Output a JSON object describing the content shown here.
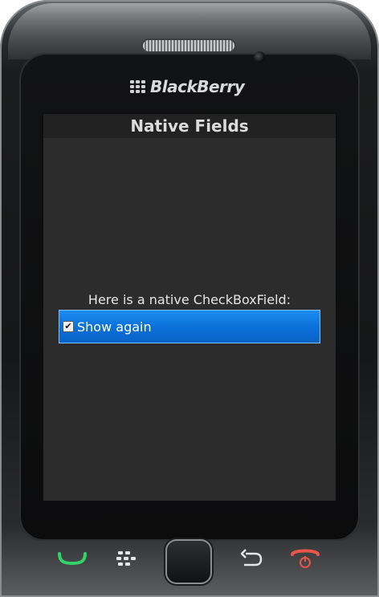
{
  "device": {
    "brand": "BlackBerry"
  },
  "screen": {
    "title": "Native Fields",
    "prompt": "Here is a native CheckBoxField:",
    "checkbox": {
      "label": "Show again",
      "checked": true
    }
  },
  "colors": {
    "focus_highlight": "#0a6fd8",
    "screen_bg": "#2c2c2c",
    "title_bar_bg": "#222222",
    "call_green": "#33d36b",
    "end_red": "#e8554d"
  },
  "icons": {
    "call": "call-icon",
    "menu": "blackberry-menu-icon",
    "back": "back-arrow-icon",
    "end": "end-call-icon"
  }
}
